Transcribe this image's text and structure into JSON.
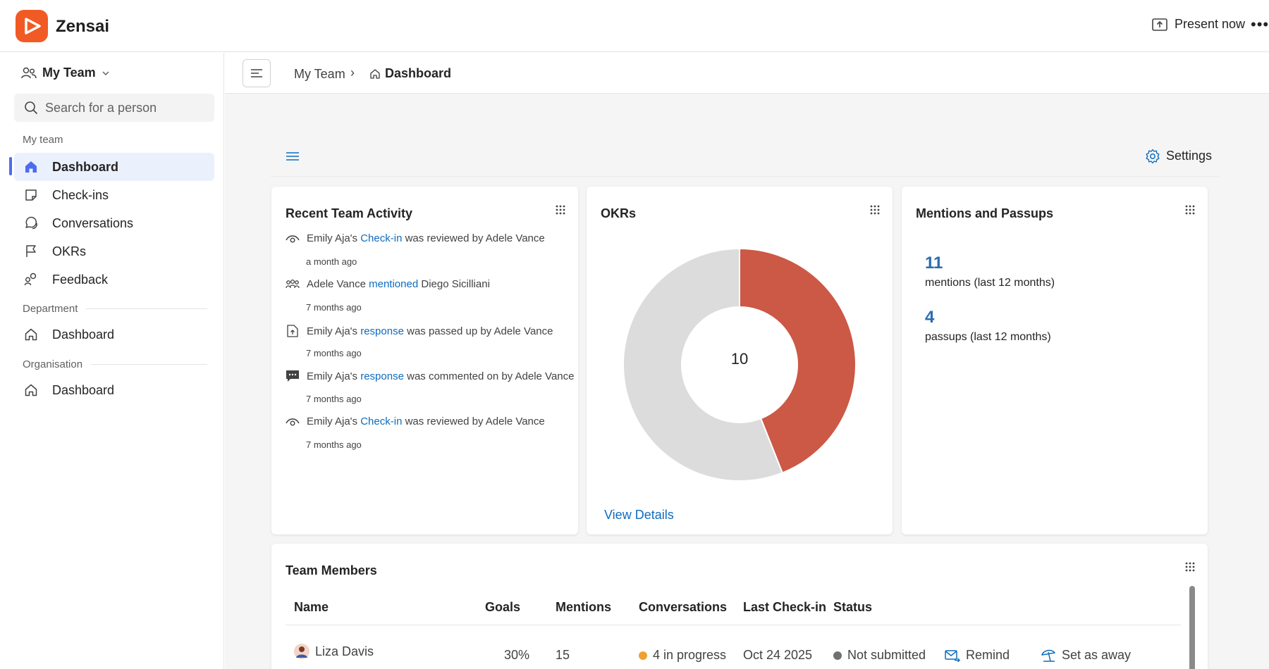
{
  "app": {
    "name": "Zensai",
    "brand_color": "#f15a24"
  },
  "topbar": {
    "present_label": "Present now",
    "more_label": "•••"
  },
  "sidebar": {
    "team_switcher": "My Team",
    "search_placeholder": "Search for a person",
    "sections": {
      "my_team": "My team",
      "department": "Department",
      "organisation": "Organisation"
    },
    "items": {
      "dashboard": "Dashboard",
      "checkins": "Check-ins",
      "conversations": "Conversations",
      "okrs": "OKRs",
      "feedback": "Feedback",
      "dept_dashboard": "Dashboard",
      "org_dashboard": "Dashboard"
    }
  },
  "breadcrumb": {
    "parent": "My Team",
    "separator": "›",
    "current": "Dashboard"
  },
  "toolbar": {
    "settings_label": "Settings"
  },
  "recent_activity": {
    "title": "Recent Team Activity",
    "items": [
      {
        "icon": "eye-icon",
        "pre": "Emily Aja's ",
        "link": "Check-in",
        "post": " was reviewed by Adele Vance",
        "time": "a month ago"
      },
      {
        "icon": "people-icon",
        "pre": "Adele Vance ",
        "link": "mentioned",
        "post": " Diego Sicilliani",
        "time": "7 months ago"
      },
      {
        "icon": "passup-icon",
        "pre": "Emily Aja's ",
        "link": "response",
        "post": " was passed up by Adele Vance",
        "time": "7 months ago"
      },
      {
        "icon": "comment-icon",
        "pre": "Emily Aja's ",
        "link": "response",
        "post": " was commented on by Adele Vance",
        "time": "7 months ago"
      },
      {
        "icon": "eye-icon",
        "pre": "Emily Aja's ",
        "link": "Check-in",
        "post": " was reviewed by Adele Vance",
        "time": "7 months ago"
      }
    ]
  },
  "okrs": {
    "title": "OKRs",
    "center_value": "10",
    "view_details": "View Details",
    "chart_data": {
      "type": "pie",
      "total": 10,
      "slices": [
        {
          "value": 0.44,
          "color": "#cc5846"
        },
        {
          "value": 0.56,
          "color": "#dcdcdc"
        }
      ]
    }
  },
  "mentions": {
    "title": "Mentions and Passups",
    "mentions_count": "11",
    "mentions_label": "mentions (last 12 months)",
    "passups_count": "4",
    "passups_label": "passups (last 12 months)"
  },
  "team_members": {
    "title": "Team Members",
    "columns": {
      "name": "Name",
      "goals": "Goals",
      "mentions": "Mentions",
      "conversations": "Conversations",
      "last_checkin": "Last Check-in",
      "status": "Status"
    },
    "rows": [
      {
        "name": "Liza Davis",
        "goals": "30%",
        "mentions": "15",
        "conversations": "4 in progress",
        "conversations_dot": "#f0a030",
        "last_checkin": "Oct 24 2025",
        "status": "Not submitted",
        "status_dot": "#707070",
        "remind": "Remind",
        "set_away": "Set as away"
      }
    ]
  }
}
